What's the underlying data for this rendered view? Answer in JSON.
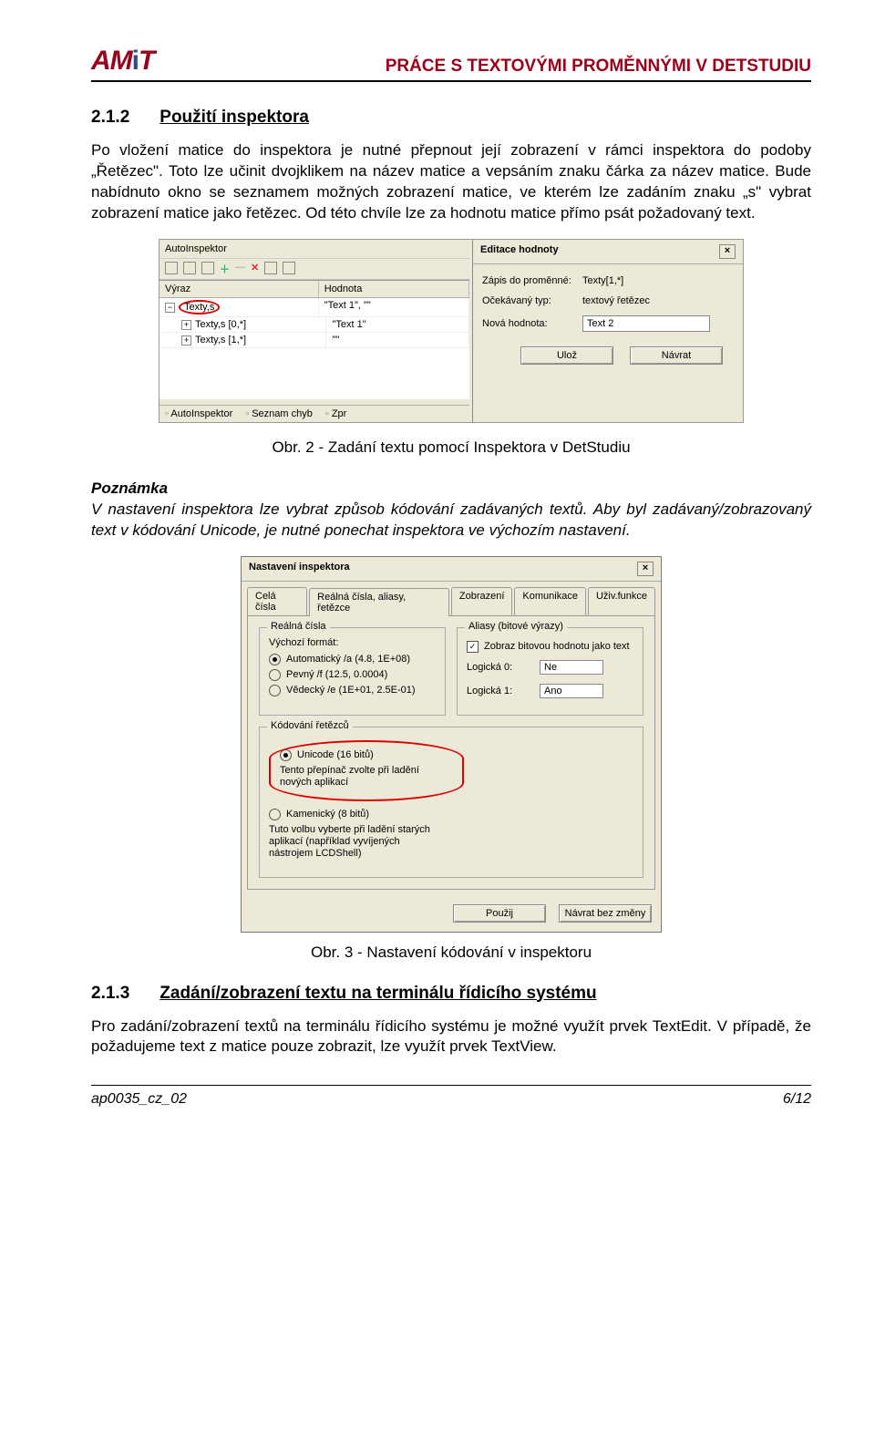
{
  "header": {
    "logo_text": "AMiT",
    "doc_title": "PRÁCE S TEXTOVÝMI PROMĚNNÝMI V DETSTUDIU"
  },
  "section1": {
    "num": "2.1.2",
    "title": "Použití inspektora",
    "para": "Po vložení matice do inspektora je nutné přepnout její zobrazení v rámci inspektora do podoby „Řetězec\". Toto lze učinit dvojklikem na název matice a vepsáním znaku čárka za název matice. Bude nabídnuto okno se seznamem možných zobrazení matice, ve kterém lze zadáním znaku „s\" vybrat zobrazení matice jako řetězec. Od této chvíle lze za hodnotu matice přímo psát požadovaný text."
  },
  "fig1": {
    "title_bar": "AutoInspektor",
    "col1": "Výraz",
    "col2": "Hodnota",
    "row1_col1": "Texty,s",
    "row1_col2": "\"Text 1\", \"\"",
    "row2_col1": "Texty,s [0,*]",
    "row2_col2": "\"Text 1\"",
    "row3_col1": "Texty,s [1,*]",
    "row3_col2": "\"\"",
    "tab1": "AutoInspektor",
    "tab2": "Seznam chyb",
    "tab3": "Zpr",
    "dlg_title": "Editace hodnoty",
    "lbl_zapis": "Zápis do proměnné:",
    "val_zapis": "Texty[1,*]",
    "lbl_ocek": "Očekávaný typ:",
    "val_ocek": "textový řetězec",
    "lbl_nova": "Nová hodnota:",
    "val_nova": "Text 2",
    "btn_uloz": "Ulož",
    "btn_navrat": "Návrat",
    "caption": "Obr. 2 - Zadání textu pomocí Inspektora v DetStudiu"
  },
  "note": {
    "head": "Poznámka",
    "body": "V nastavení inspektora lze vybrat způsob kódování zadávaných textů. Aby byl zadávaný/zobrazovaný text v kódování Unicode, je nutné ponechat inspektora ve výchozím nastavení."
  },
  "fig2": {
    "title": "Nastavení inspektora",
    "tab1": "Celá čísla",
    "tab2": "Reálná čísla, aliasy, řetězce",
    "tab3": "Zobrazení",
    "tab4": "Komunikace",
    "tab5": "Uživ.funkce",
    "g1_title": "Reálná čísla",
    "g1_lbl": "Výchozí formát:",
    "g1_r1": "Automatický /a (4.8, 1E+08)",
    "g1_r2": "Pevný /f (12.5, 0.0004)",
    "g1_r3": "Vědecký /e (1E+01, 2.5E-01)",
    "g2_title": "Aliasy (bitové výrazy)",
    "g2_check": "Zobraz bitovou hodnotu jako text",
    "g2_lbl0": "Logická 0:",
    "g2_val0": "Ne",
    "g2_lbl1": "Logická 1:",
    "g2_val1": "Ano",
    "g3_title": "Kódování řetězců",
    "g3_r1": "Unicode (16 bitů)",
    "g3_note1": "Tento přepínač zvolte při ladění nových aplikací",
    "g3_r2": "Kamenický (8 bitů)",
    "g3_note2": "Tuto volbu vyberte při ladění starých aplikací (například vyvíjených nástrojem LCDShell)",
    "btn_pouzij": "Použij",
    "btn_navrat": "Návrat bez změny",
    "caption": "Obr. 3 - Nastavení kódování v inspektoru"
  },
  "section2": {
    "num": "2.1.3",
    "title": "Zadání/zobrazení textu na terminálu řídicího systému",
    "para": "Pro zadání/zobrazení textů na terminálu řídicího systému je možné využít prvek TextEdit. V případě, že požadujeme text z matice pouze zobrazit, lze využít prvek TextView."
  },
  "footer": {
    "left": "ap0035_cz_02",
    "right": "6/12"
  }
}
